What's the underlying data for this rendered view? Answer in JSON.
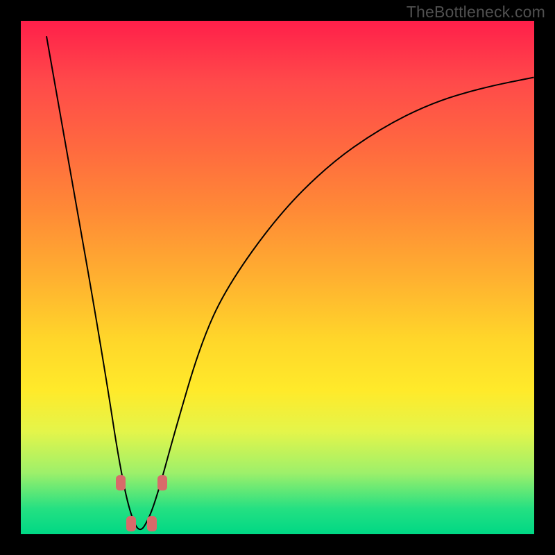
{
  "watermark": "TheBottleneck.com",
  "frame": {
    "outer_size": 800,
    "border": 30,
    "inner_x": 30,
    "inner_y": 30,
    "inner_w": 740,
    "inner_h": 740
  },
  "colors": {
    "border": "#000000",
    "curve": "#000000",
    "marker": "#d86a6a"
  },
  "chart_data": {
    "type": "line",
    "title": "",
    "xlabel": "",
    "ylabel": "",
    "xlim": [
      0,
      100
    ],
    "ylim": [
      0,
      100
    ],
    "grid": false,
    "notes": "V-shaped bottleneck curve on rainbow gradient background. x is relative balance parameter (0-100), y is bottleneck severity (0 best, 100 worst). Minimum around x≈23.",
    "series": [
      {
        "name": "bottleneck-curve",
        "x": [
          5,
          8,
          11,
          14,
          17,
          19,
          21,
          23,
          25,
          27,
          30,
          35,
          40,
          50,
          60,
          70,
          80,
          90,
          100
        ],
        "values": [
          97,
          80,
          63,
          46,
          28,
          15,
          5,
          0,
          3,
          9,
          20,
          37,
          48,
          62,
          72,
          79,
          84,
          87,
          89
        ]
      }
    ],
    "markers": [
      {
        "x": 19.5,
        "y": 10
      },
      {
        "x": 27.5,
        "y": 10
      },
      {
        "x": 21.5,
        "y": 2
      },
      {
        "x": 25.5,
        "y": 2
      }
    ],
    "background_gradient": [
      "#ff1f4a",
      "#ffd62a",
      "#00d885"
    ]
  }
}
